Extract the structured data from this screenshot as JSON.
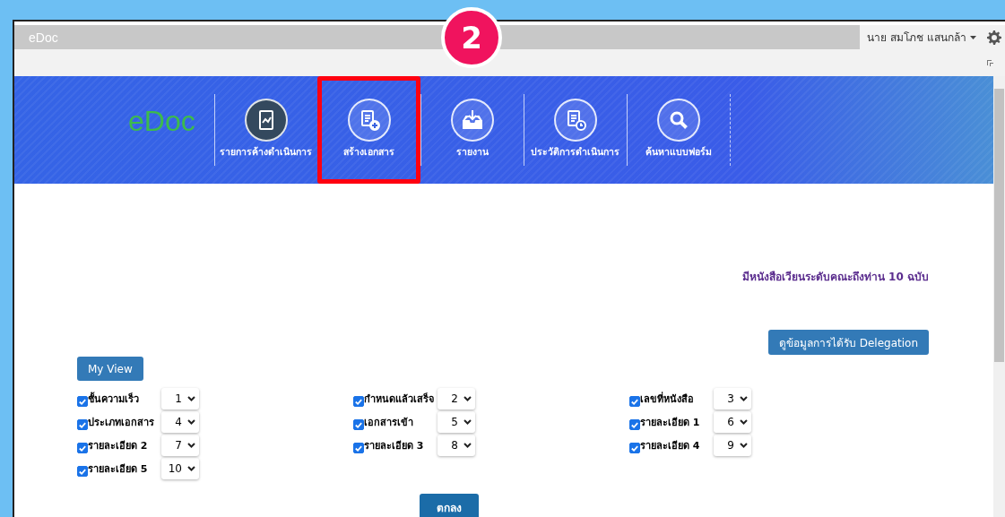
{
  "window": {
    "title": "eDoc"
  },
  "user_menu": {
    "label": "นาย สมโภช แสนกล้า"
  },
  "step_marker": {
    "label": "2"
  },
  "banner": {
    "logo": "eDoc",
    "nav": [
      {
        "label": "รายการค้างดำเนินการ",
        "kind": "chart",
        "selected": true,
        "highlighted": false
      },
      {
        "label": "สร้างเอกสาร",
        "kind": "doc-add",
        "selected": false,
        "highlighted": true
      },
      {
        "label": "รายงาน",
        "kind": "inbox",
        "selected": false,
        "highlighted": false
      },
      {
        "label": "ประวัติการดำเนินการ",
        "kind": "doc-clock",
        "selected": false,
        "highlighted": false
      },
      {
        "label": "ค้นหาแบบฟอร์ม",
        "kind": "search",
        "selected": false,
        "highlighted": false
      }
    ]
  },
  "notice": "มีหนังสือเวียนระดับคณะถึงท่าน 10 ฉบับ",
  "delegation_button": "ดูข้อมูลการได้รับ Delegation",
  "my_view_button": "My View",
  "columns": [
    {
      "label": "ชั้นความเร็ว",
      "checked": true,
      "order": "1"
    },
    {
      "label": "กำหนดแล้วเสร็จ",
      "checked": true,
      "order": "2"
    },
    {
      "label": "เลขที่หนังสือ",
      "checked": true,
      "order": "3"
    },
    {
      "label": "ประเภทเอกสาร",
      "checked": true,
      "order": "4"
    },
    {
      "label": "เอกสารเข้า",
      "checked": true,
      "order": "5"
    },
    {
      "label": "รายละเอียด 1",
      "checked": true,
      "order": "6"
    },
    {
      "label": "รายละเอียด 2",
      "checked": true,
      "order": "7"
    },
    {
      "label": "รายละเอียด 3",
      "checked": true,
      "order": "8"
    },
    {
      "label": "รายละเอียด 4",
      "checked": true,
      "order": "9"
    },
    {
      "label": "รายละเอียด 5",
      "checked": true,
      "order": "10"
    }
  ],
  "ok_button": "ตกลง"
}
